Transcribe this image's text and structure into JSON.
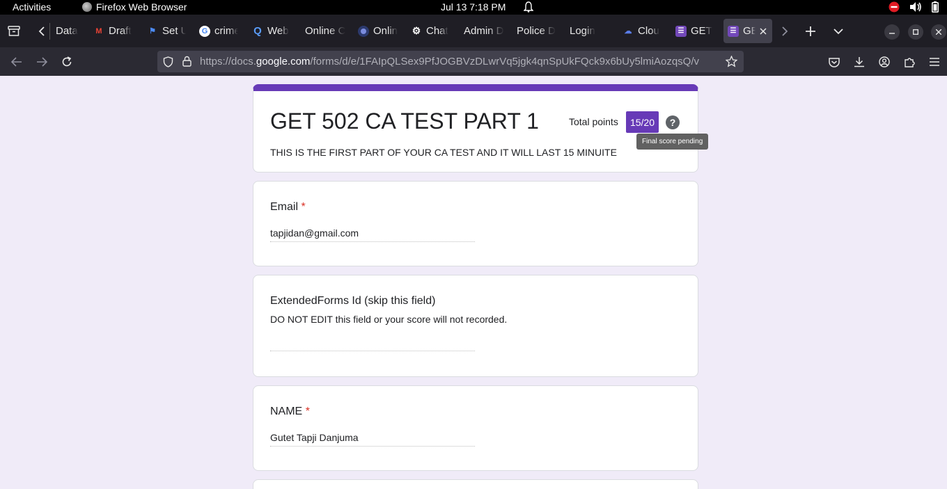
{
  "system": {
    "activities": "Activities",
    "app_name": "Firefox Web Browser",
    "datetime": "Jul 13   7:18 PM"
  },
  "tabs": [
    {
      "label": "Data",
      "favicon": "none"
    },
    {
      "label": "Draft",
      "favicon": "gmail-icon",
      "color": "#ea4335"
    },
    {
      "label": "Set U",
      "favicon": "flag-icon",
      "color": "#4c8bf5"
    },
    {
      "label": "crime",
      "favicon": "google-icon",
      "color": "#ffffff"
    },
    {
      "label": "Web",
      "favicon": "search-icon",
      "color": "#5a9cf8"
    },
    {
      "label": "Online C",
      "favicon": "none"
    },
    {
      "label": "Onlin",
      "favicon": "circle-icon",
      "color": "#7b8cde"
    },
    {
      "label": "Chat",
      "favicon": "chatgpt-icon",
      "color": "#ffffff"
    },
    {
      "label": "Admin D",
      "favicon": "none"
    },
    {
      "label": "Police D",
      "favicon": "none"
    },
    {
      "label": "Login",
      "favicon": "none"
    },
    {
      "label": "Clou",
      "favicon": "cloud-icon",
      "color": "#5a7de8"
    },
    {
      "label": "GET",
      "favicon": "forms-icon",
      "color": "#7248b9"
    },
    {
      "label": "GE",
      "favicon": "forms-icon",
      "color": "#7248b9",
      "active": true
    }
  ],
  "navbar": {
    "url_prefix": "https://docs.",
    "url_domain": "google.com",
    "url_rest": "/forms/d/e/1FAIpQLSex9PfJOGBVzDLwrVq5jgk4qnSpUkFQck9x6bUy5lmiAozqsQ/v"
  },
  "form": {
    "accent": "#673ab7",
    "title": "GET 502 CA TEST PART 1",
    "description": "THIS IS THE FIRST PART OF YOUR CA TEST AND IT WILL LAST 15 MINUITE",
    "points_label": "Total points",
    "points_value": "15/20",
    "help_glyph": "?",
    "tooltip": "Final score pending",
    "questions": [
      {
        "title": "Email",
        "required": true,
        "answer": "tapjidan@gmail.com"
      },
      {
        "title": "ExtendedForms Id (skip this field)",
        "required": false,
        "help": "DO NOT EDIT this field or your score will not recorded.",
        "answer": ""
      },
      {
        "title": "NAME",
        "required": true,
        "answer": "Gutet Tapji Danjuma"
      }
    ],
    "required_mark": "*"
  }
}
